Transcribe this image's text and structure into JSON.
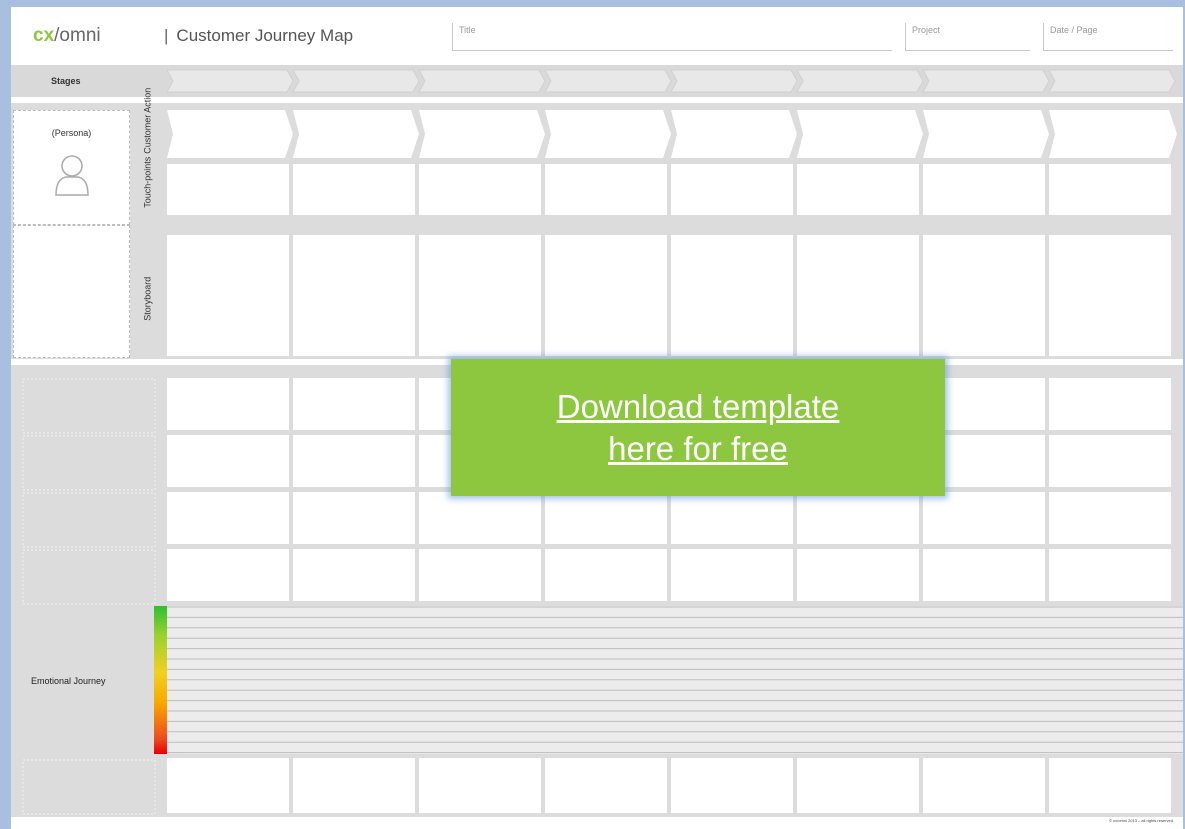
{
  "header": {
    "logo_cx": "cx",
    "logo_rest": "/omni",
    "separator": "|",
    "title": "Customer Journey Map",
    "field_title": "Title",
    "field_project": "Project",
    "field_date": "Date / Page"
  },
  "rows": {
    "stages": "Stages",
    "persona": "(Persona)",
    "customer_action": "Customer Action",
    "touchpoints": "Touch-points",
    "storyboard": "Storyboard",
    "emotional_journey": "Emotional Journey"
  },
  "cta": {
    "line1": "Download template",
    "line2": "here for free"
  },
  "footer": "© cx/omni 2013 – all rights reserved",
  "colors": {
    "accent": "#8dc63f",
    "background": "#a9bfe0",
    "band": "#dcdcdc"
  },
  "icons": {
    "persona": "user-outline-icon"
  }
}
